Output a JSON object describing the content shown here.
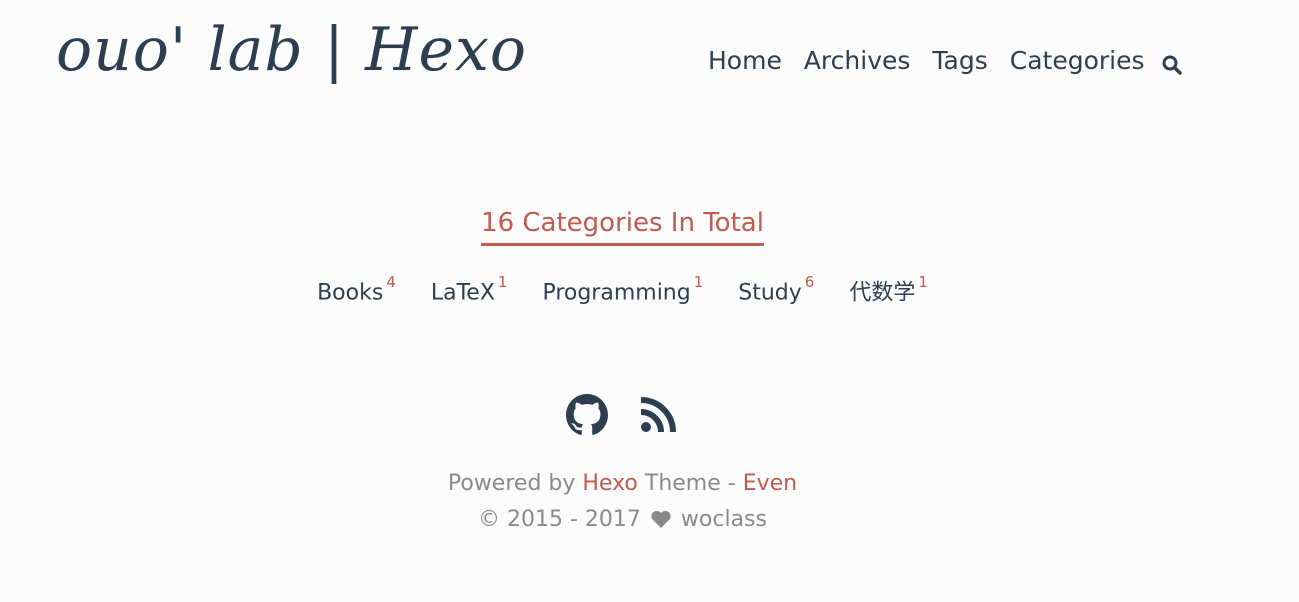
{
  "header": {
    "logo": "ouo' lab | Hexo",
    "nav": [
      {
        "label": "Home"
      },
      {
        "label": "Archives"
      },
      {
        "label": "Tags"
      },
      {
        "label": "Categories"
      }
    ],
    "search_icon": "search-icon"
  },
  "main": {
    "title": "16 Categories In Total",
    "categories": [
      {
        "name": "Books",
        "count": "4"
      },
      {
        "name": "LaTeX",
        "count": "1"
      },
      {
        "name": "Programming",
        "count": "1"
      },
      {
        "name": "Study",
        "count": "6"
      },
      {
        "name": "代数学",
        "count": "1"
      }
    ]
  },
  "footer": {
    "social_icons": [
      "github-icon",
      "rss-icon"
    ],
    "powered_prefix": "Powered by",
    "hexo_label": "Hexo",
    "theme_label": "Theme -",
    "even_label": "Even",
    "copyright": "© 2015 - 2017",
    "author": "woclass"
  },
  "colors": {
    "text": "#2c3e50",
    "accent": "#c05b4d",
    "muted": "#8a8a8a",
    "background": "#fcfcfc"
  }
}
